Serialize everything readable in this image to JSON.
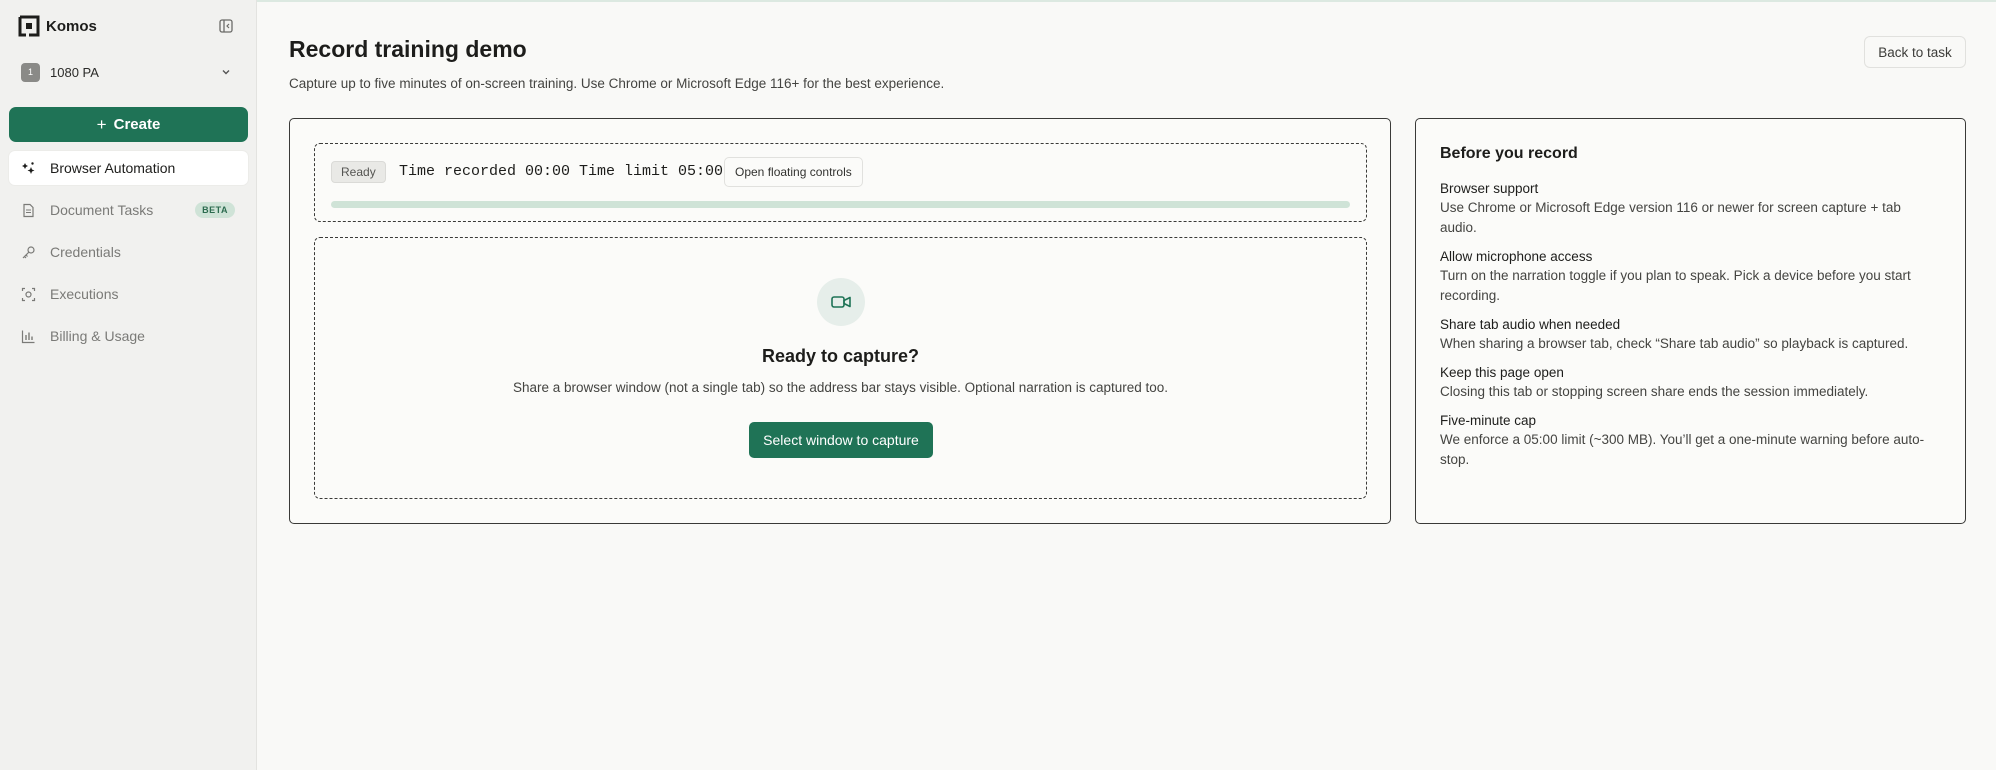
{
  "app": {
    "name": "Komos"
  },
  "org": {
    "avatar": "1",
    "name": "1080 PA"
  },
  "sidebar": {
    "create_label": "Create",
    "items": [
      {
        "label": "Browser Automation",
        "icon": "automation-icon",
        "active": true
      },
      {
        "label": "Document Tasks",
        "icon": "document-icon",
        "badge": "BETA"
      },
      {
        "label": "Credentials",
        "icon": "key-icon"
      },
      {
        "label": "Executions",
        "icon": "executions-icon"
      },
      {
        "label": "Billing & Usage",
        "icon": "chart-icon"
      }
    ]
  },
  "header": {
    "title": "Record training demo",
    "subtitle": "Capture up to five minutes of on-screen training. Use Chrome or Microsoft Edge 116+ for the best experience.",
    "back_label": "Back to task"
  },
  "recorder": {
    "status": "Ready",
    "timer_text": "Time recorded 00:00 Time limit 05:00",
    "floating_label": "Open floating controls",
    "progress_fraction": 0,
    "capture_title": "Ready to capture?",
    "capture_desc": "Share a browser window (not a single tab) so the address bar stays visible. Optional narration is captured too.",
    "select_label": "Select window to capture",
    "camera_icon": "video-camera-icon"
  },
  "tips": {
    "title": "Before you record",
    "items": [
      {
        "head": "Browser support",
        "body": "Use Chrome or Microsoft Edge version 116 or newer for screen capture + tab audio."
      },
      {
        "head": "Allow microphone access",
        "body": "Turn on the narration toggle if you plan to speak. Pick a device before you start recording."
      },
      {
        "head": "Share tab audio when needed",
        "body": "When sharing a browser tab, check “Share tab audio” so playback is captured."
      },
      {
        "head": "Keep this page open",
        "body": "Closing this tab or stopping screen share ends the session immediately."
      },
      {
        "head": "Five-minute cap",
        "body": "We enforce a 05:00 limit (~300 MB). You’ll get a one-minute warning before auto-stop."
      }
    ]
  },
  "colors": {
    "accent": "#1f7356",
    "accent_light": "#cfe3d7",
    "sidebar_bg": "#f1f1ef",
    "page_bg": "#f9f9f7"
  }
}
